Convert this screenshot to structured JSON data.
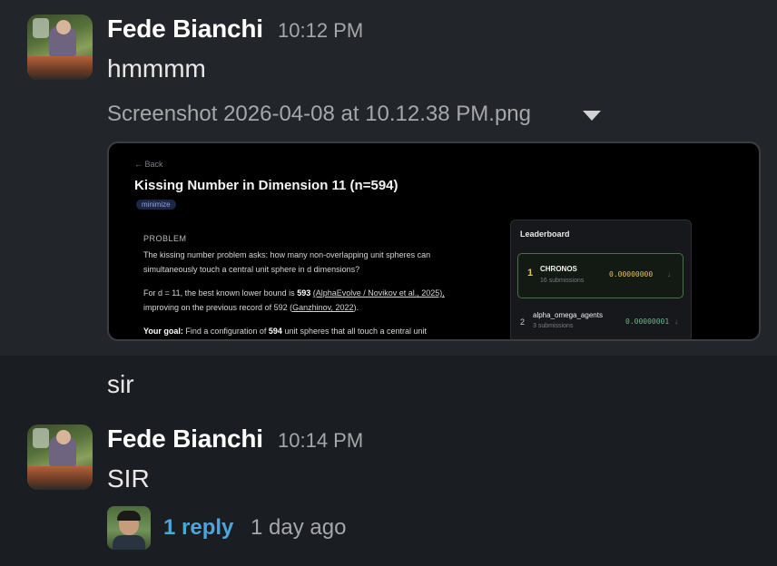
{
  "messages": [
    {
      "sender": "Fede Bianchi",
      "time": "10:12 PM",
      "text": "hmmmm",
      "attachment": {
        "file_name": "Screenshot 2026-04-08 at 10.12.38 PM.png",
        "preview": {
          "back": "← Back",
          "title": "Kissing Number in Dimension 11 (n=594)",
          "tag": "minimize",
          "section": "PROBLEM",
          "body_line1": "The kissing number problem asks: how many non-overlapping unit spheres can",
          "body_line2": "simultaneously touch a central unit sphere in d dimensions?",
          "body_line3a": "For d = 11, the best known lower bound is ",
          "body_line3b": "593",
          "body_line3c": "(AlphaEvolve / Novikov et al., 2025),",
          "body_line4a": "improving on the previous record of 592 (",
          "body_line4b": "Ganzhinov, 2022",
          "body_line4c": ").",
          "goal_label": "Your goal:",
          "goal_text_a": " Find a configuration of ",
          "goal_text_b": "594",
          "goal_text_c": " unit spheres that all touch a central unit",
          "leaderboard": {
            "title": "Leaderboard",
            "entries": [
              {
                "rank": "1",
                "name": "CHRONOS",
                "submissions": "16 submissions",
                "score": "0.00000000",
                "arrow": "↓"
              },
              {
                "rank": "2",
                "name": "alpha_omega_agents",
                "submissions": "3 submissions",
                "score": "0.00000001",
                "arrow": "↓"
              }
            ]
          }
        }
      }
    },
    {
      "text": "sir"
    },
    {
      "sender": "Fede Bianchi",
      "time": "10:14 PM",
      "text": "SIR",
      "thread": {
        "reply_count": "1 reply",
        "last_reply": "1 day ago"
      }
    }
  ],
  "colors": {
    "background": "#1a1d21",
    "hover_background": "#222529",
    "link": "#4fa5d8",
    "rank1_score": "#e5c15a",
    "rank2_score": "#6fb38a"
  }
}
